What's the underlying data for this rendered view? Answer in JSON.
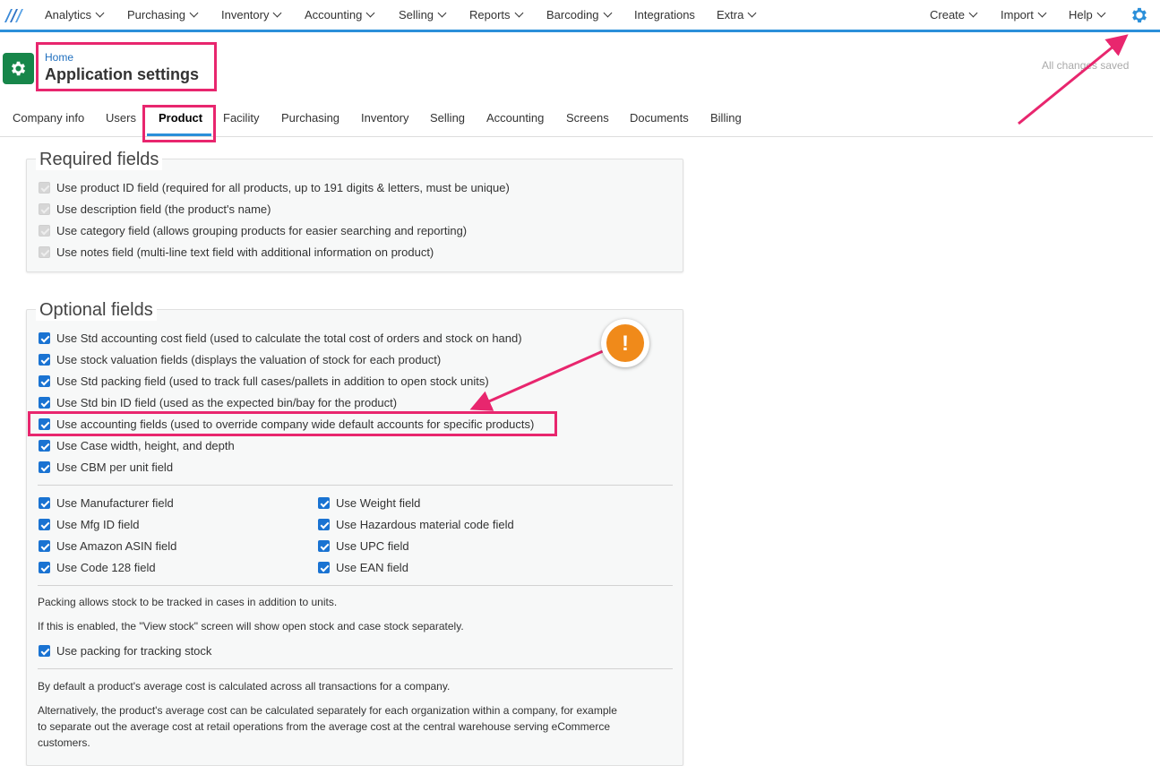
{
  "nav": {
    "left": [
      "Analytics",
      "Purchasing",
      "Inventory",
      "Accounting",
      "Selling",
      "Reports",
      "Barcoding",
      "Integrations",
      "Extra"
    ],
    "right": [
      "Create",
      "Import",
      "Help"
    ]
  },
  "header": {
    "breadcrumb": "Home",
    "title": "Application settings",
    "status": "All changes saved"
  },
  "tabs": [
    "Company info",
    "Users",
    "Product",
    "Facility",
    "Purchasing",
    "Inventory",
    "Selling",
    "Accounting",
    "Screens",
    "Documents",
    "Billing"
  ],
  "required": {
    "legend": "Required fields",
    "items": [
      "Use product ID field (required for all products, up to 191 digits & letters, must be unique)",
      "Use description field (the product's name)",
      "Use category field (allows grouping products for easier searching and reporting)",
      "Use notes field (multi-line text field with additional information on product)"
    ]
  },
  "optional": {
    "legend": "Optional fields",
    "items": [
      "Use Std accounting cost field (used to calculate the total cost of orders and stock on hand)",
      "Use stock valuation fields (displays the valuation of stock for each product)",
      "Use Std packing field (used to track full cases/pallets in addition to open stock units)",
      "Use Std bin ID field (used as the expected bin/bay for the product)",
      "Use accounting fields (used to override company wide default accounts for specific products)",
      "Use Case width, height, and depth",
      "Use CBM per unit field"
    ],
    "grid_left": [
      "Use Manufacturer field",
      "Use Mfg ID field",
      "Use Amazon ASIN field",
      "Use Code 128 field"
    ],
    "grid_right": [
      "Use Weight field",
      "Use Hazardous material code field",
      "Use UPC field",
      "Use EAN field"
    ],
    "packing_text_1": "Packing allows stock to be tracked in cases in addition to units.",
    "packing_text_2": "If this is enabled, the \"View stock\" screen will show open stock and case stock separately.",
    "packing_checkbox": "Use packing for tracking stock",
    "avg_text_1": "By default a product's average cost is calculated across all transactions for a company.",
    "avg_text_2": "Alternatively, the product's average cost can be calculated separately for each organization within a company, for example to separate out the average cost at retail operations from the average cost at the central warehouse serving eCommerce customers."
  },
  "annotation": {
    "mark": "!"
  },
  "colors": {
    "accent": "#2b8fd9",
    "highlight": "#e8266e",
    "checkbox": "#1a73d2",
    "app_icon": "#17864a",
    "warning": "#f08a1a"
  },
  "icons": [
    "logo-icon",
    "chevron-down-icon",
    "gear-icon",
    "settings-app-icon",
    "checkbox-icon",
    "warning-icon",
    "arrow-icon"
  ]
}
